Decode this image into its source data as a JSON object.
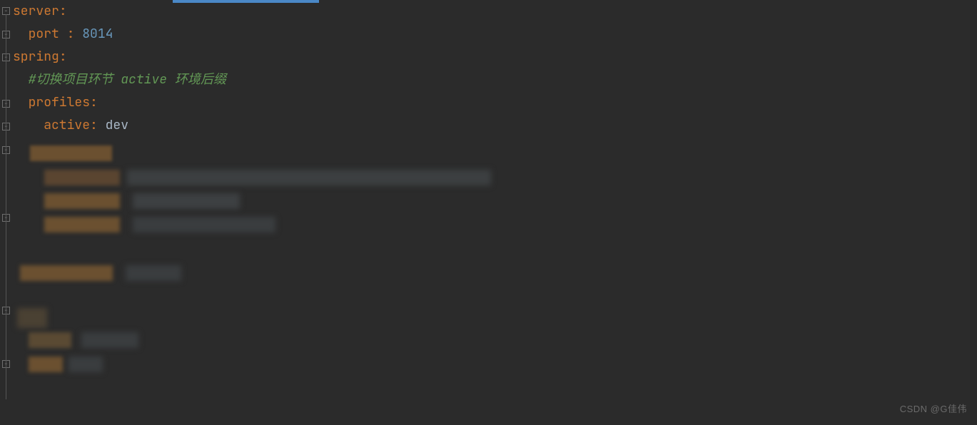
{
  "code": {
    "line1": {
      "key": "server",
      "colon": ":"
    },
    "line2": {
      "indent": "  ",
      "key": "port ",
      "colon": ": ",
      "value": "8014"
    },
    "line3": {
      "key": "spring",
      "colon": ":"
    },
    "line4": {
      "indent": "  ",
      "comment_prefix": "#切换项目环节 ",
      "comment_em": "active",
      "comment_suffix": " 环境后缀"
    },
    "line5": {
      "indent": "  ",
      "key": "profiles",
      "colon": ":"
    },
    "line6": {
      "indent": "    ",
      "key": "active",
      "colon": ": ",
      "value": "dev"
    }
  },
  "watermark": "CSDN @G佳伟"
}
